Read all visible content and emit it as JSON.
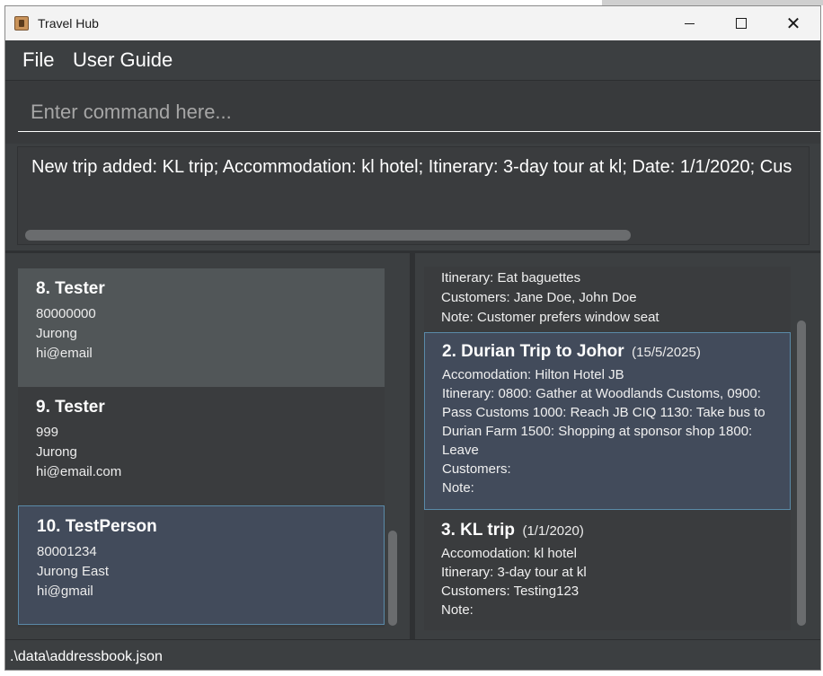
{
  "window": {
    "title": "Travel Hub"
  },
  "menu": {
    "file": "File",
    "user_guide": "User Guide"
  },
  "command": {
    "placeholder": "Enter command here...",
    "value": ""
  },
  "result": {
    "text": "New trip added: KL trip; Accommodation: kl hotel; Itinerary: 3-day tour at kl; Date: 1/1/2020; Cus"
  },
  "persons": [
    {
      "index_name": "8. Tester",
      "phone": "80000000",
      "address": "Jurong",
      "email": "hi@email"
    },
    {
      "index_name": "9. Tester",
      "phone": "999",
      "address": "Jurong",
      "email": "hi@email.com"
    },
    {
      "index_name": "10. TestPerson",
      "phone": "80001234",
      "address": "Jurong East",
      "email": "hi@gmail"
    }
  ],
  "trips_partial": {
    "itinerary": "Itinerary: Eat baguettes",
    "customers": "Customers: Jane Doe, John Doe",
    "note": "Note: Customer prefers window seat"
  },
  "trips": [
    {
      "index_name": "2.  Durian Trip to Johor",
      "date": "(15/5/2025)",
      "accommodation": "Accomodation: Hilton Hotel JB",
      "itinerary": "Itinerary: 0800: Gather at Woodlands Customs, 0900: Pass Customs 1000: Reach JB CIQ 1130: Take bus to Durian Farm 1500: Shopping at sponsor shop 1800: Leave",
      "customers": "Customers:",
      "note": "Note:"
    },
    {
      "index_name": "3.  KL trip",
      "date": "(1/1/2020)",
      "accommodation": "Accomodation: kl hotel",
      "itinerary": "Itinerary: 3-day tour at kl",
      "customers": "Customers: Testing123",
      "note": "Note:"
    }
  ],
  "status": {
    "path": ".\\data\\addressbook.json"
  }
}
